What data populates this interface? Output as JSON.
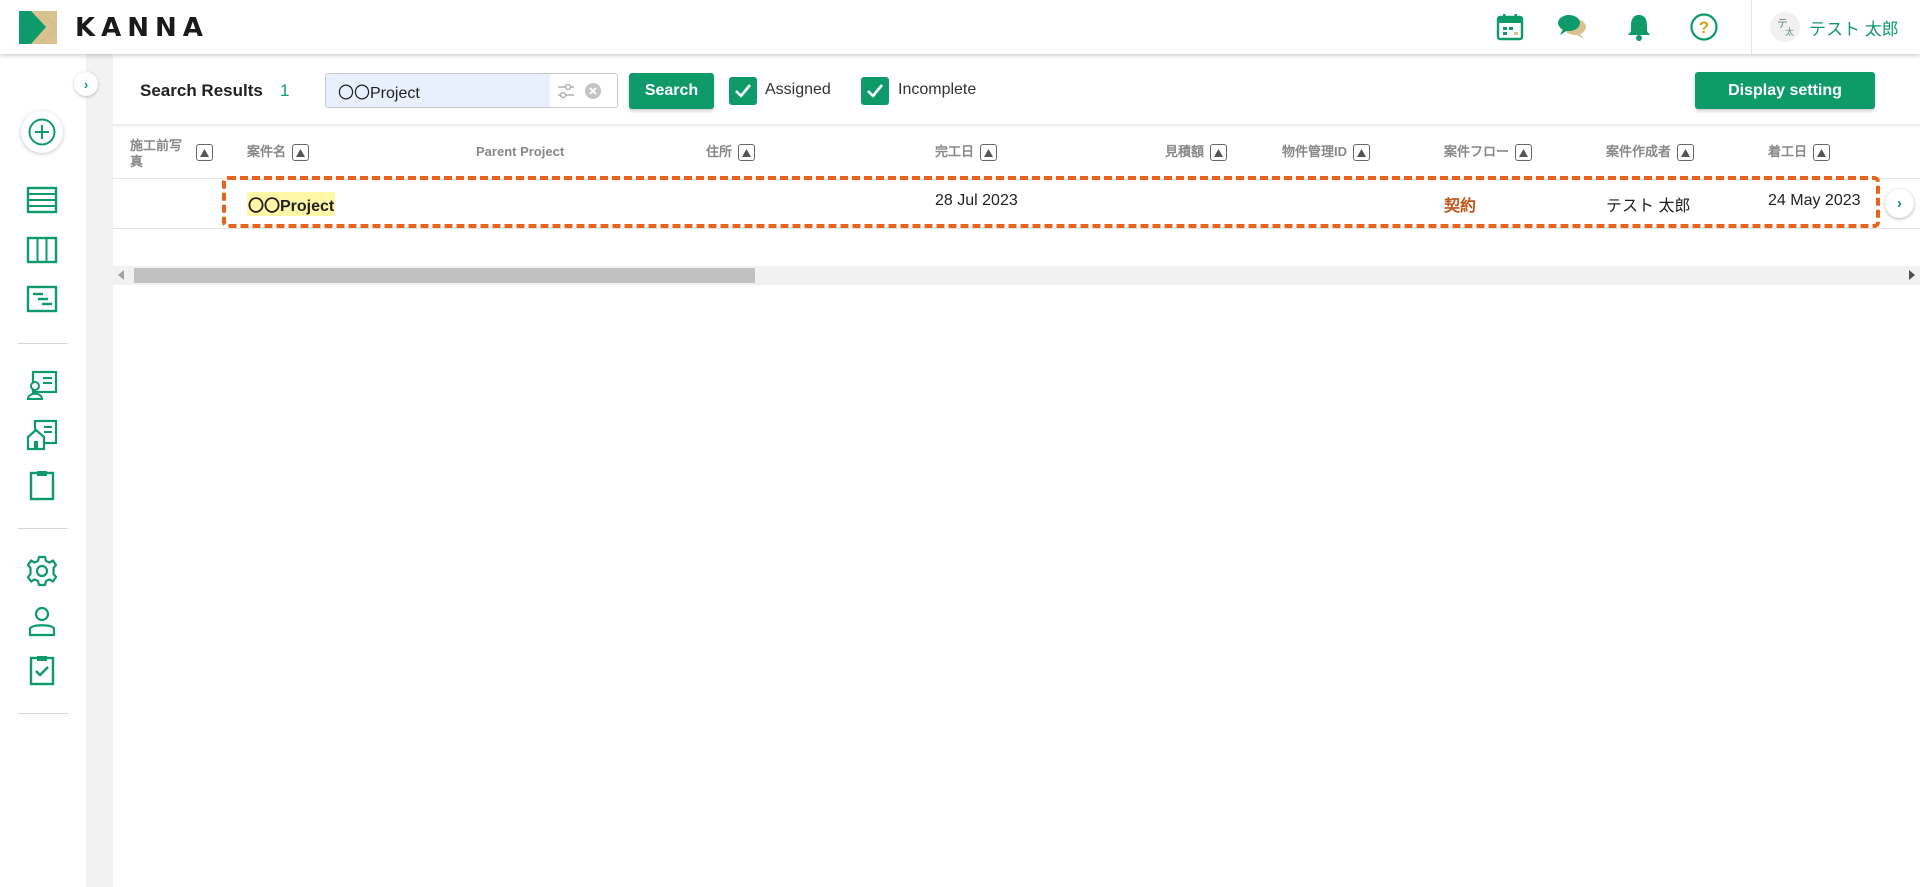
{
  "header": {
    "logo_text": "KANNA",
    "icons": [
      "calendar-icon",
      "chat-icon",
      "bell-icon",
      "help-icon"
    ],
    "user": {
      "avatar_top": "テ",
      "avatar_bottom": "太",
      "name": "テスト 太郎"
    }
  },
  "sidebar": {
    "toggle_glyph": "›",
    "icons": [
      "add-icon",
      "list-view-icon",
      "board-view-icon",
      "gantt-view-icon",
      "customer-icon",
      "property-icon",
      "clipboard-icon",
      "settings-icon",
      "user-icon",
      "checklist-icon"
    ]
  },
  "toolbar": {
    "title": "Search Results",
    "count": "1",
    "search_value": "〇〇Project",
    "search_button": "Search",
    "filter_assigned": "Assigned",
    "filter_incomplete": "Incomplete",
    "display_setting": "Display setting"
  },
  "table": {
    "headers": {
      "photo": "施工前写真",
      "name": "案件名",
      "parent": "Parent Project",
      "address": "住所",
      "completion": "完工日",
      "estimate": "見積額",
      "property_id": "物件管理ID",
      "flow": "案件フロー",
      "creator": "案件作成者",
      "start": "着工日"
    },
    "rows": [
      {
        "name": "〇〇Project",
        "completion": "28 Jul 2023",
        "flow": "契約",
        "creator": "テスト 太郎",
        "start": "24 May 2023"
      }
    ],
    "row_next_glyph": "›"
  },
  "colors": {
    "brand": "#0f9a6a",
    "highlight": "#e8631c",
    "flow": "#c0561c",
    "name_highlight": "#fff8a8"
  }
}
